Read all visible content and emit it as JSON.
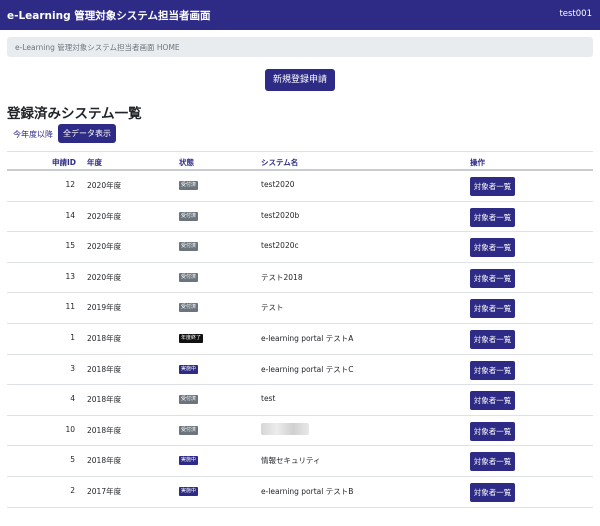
{
  "navbar": {
    "brand": "e-Learning 管理対象システム担当者画面",
    "user": "test001"
  },
  "breadcrumb": "e-Learning 管理対象システム担当者画面 HOME",
  "new_button": "新規登録申請",
  "section_title": "登録済みシステム一覧",
  "filters": {
    "current": "今年度以降",
    "all": "全データ表示"
  },
  "headers": {
    "id": "申請ID",
    "year": "年度",
    "status": "状態",
    "system": "システム名",
    "action": "操作"
  },
  "status_colors": {
    "受付済": "#6c757d",
    "実施中": "#2e2b86",
    "年度終了": "#111111"
  },
  "rows": [
    {
      "id": "12",
      "year": "2020年度",
      "status": "受付済",
      "system": "test2020",
      "action": "対象者一覧"
    },
    {
      "id": "14",
      "year": "2020年度",
      "status": "受付済",
      "system": "test2020b",
      "action": "対象者一覧"
    },
    {
      "id": "15",
      "year": "2020年度",
      "status": "受付済",
      "system": "test2020c",
      "action": "対象者一覧"
    },
    {
      "id": "13",
      "year": "2020年度",
      "status": "受付済",
      "system": "テスト2018",
      "action": "対象者一覧"
    },
    {
      "id": "11",
      "year": "2019年度",
      "status": "受付済",
      "system": "テスト",
      "action": "対象者一覧"
    },
    {
      "id": "1",
      "year": "2018年度",
      "status": "年度終了",
      "system": "e-learning portal テストA",
      "action": "対象者一覧"
    },
    {
      "id": "3",
      "year": "2018年度",
      "status": "実施中",
      "system": "e-learning portal テストC",
      "action": "対象者一覧"
    },
    {
      "id": "4",
      "year": "2018年度",
      "status": "受付済",
      "system": "test",
      "action": "対象者一覧"
    },
    {
      "id": "10",
      "year": "2018年度",
      "status": "受付済",
      "system": "",
      "action": "対象者一覧"
    },
    {
      "id": "5",
      "year": "2018年度",
      "status": "実施中",
      "system": "情報セキュリティ",
      "action": "対象者一覧"
    },
    {
      "id": "2",
      "year": "2017年度",
      "status": "実施中",
      "system": "e-learning portal テストB",
      "action": "対象者一覧"
    }
  ]
}
